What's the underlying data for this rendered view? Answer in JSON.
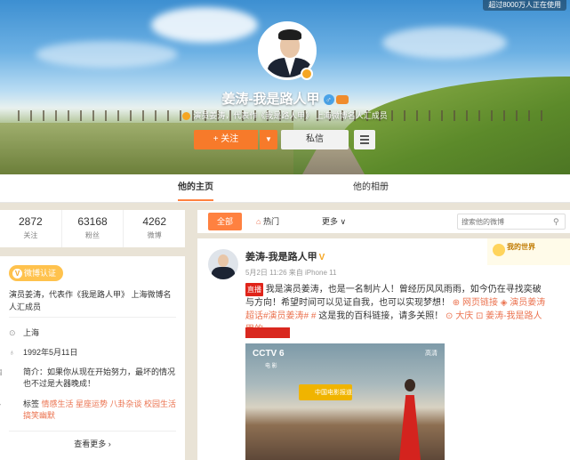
{
  "cover": {
    "user_count": "超过8000万人正在使用"
  },
  "profile": {
    "name": "姜涛-我是路人甲",
    "gender_icon": "♂",
    "description": "演员姜涛，代表作《我是路人甲》 上海微博名人汇成员",
    "follow_label": "+ 关注",
    "follow_more": "▼",
    "message_label": "私信"
  },
  "tabs": [
    {
      "label": "他的主页",
      "active": true
    },
    {
      "label": "他的相册",
      "active": false
    }
  ],
  "stats": [
    {
      "num": "2872",
      "label": "关注"
    },
    {
      "num": "63168",
      "label": "粉丝"
    },
    {
      "num": "4262",
      "label": "微博"
    }
  ],
  "info": {
    "verify_label": "微博认证",
    "verify_text": "演员姜涛，代表作《我是路人甲》 上海微博名人汇成员",
    "location": "上海",
    "birthday": "1992年5月11日",
    "bio": "简介：如果你从现在开始努力，最坏的情况也不过是大器晚成！",
    "tags_label": "标签",
    "tags": "情感生活 星座运势 八卦杂谈 校园生活 搞笑幽默",
    "more": "查看更多 ›"
  },
  "feed": {
    "tab_all": "全部",
    "tab_hot": "热门",
    "tab_more": "更多 ∨",
    "search_placeholder": "搜索他的微博",
    "ad_text": "我的世界"
  },
  "post": {
    "name": "姜涛-我是路人甲",
    "verified_mark": "V",
    "meta": "5月2日 11:26 来自 iPhone 11",
    "red_chip": "直播",
    "text_main": "我是演员姜涛，也是一名制片人！曾经历风风雨雨，如今仍在寻找奕破与方向！希望时间可以见证自我，也可以实现梦想！",
    "link_web": "网页链接",
    "link_topic": "演员姜涛超话#演员姜涛#",
    "text_tail": "这是我的百科链接，请多关照！",
    "link_place": "大庆",
    "link_user": "姜涛-我是路人甲的",
    "image": {
      "channel": "CCTV 6",
      "channel_sub": "电 影",
      "show": "中国电影报道",
      "quality": "高清"
    }
  }
}
